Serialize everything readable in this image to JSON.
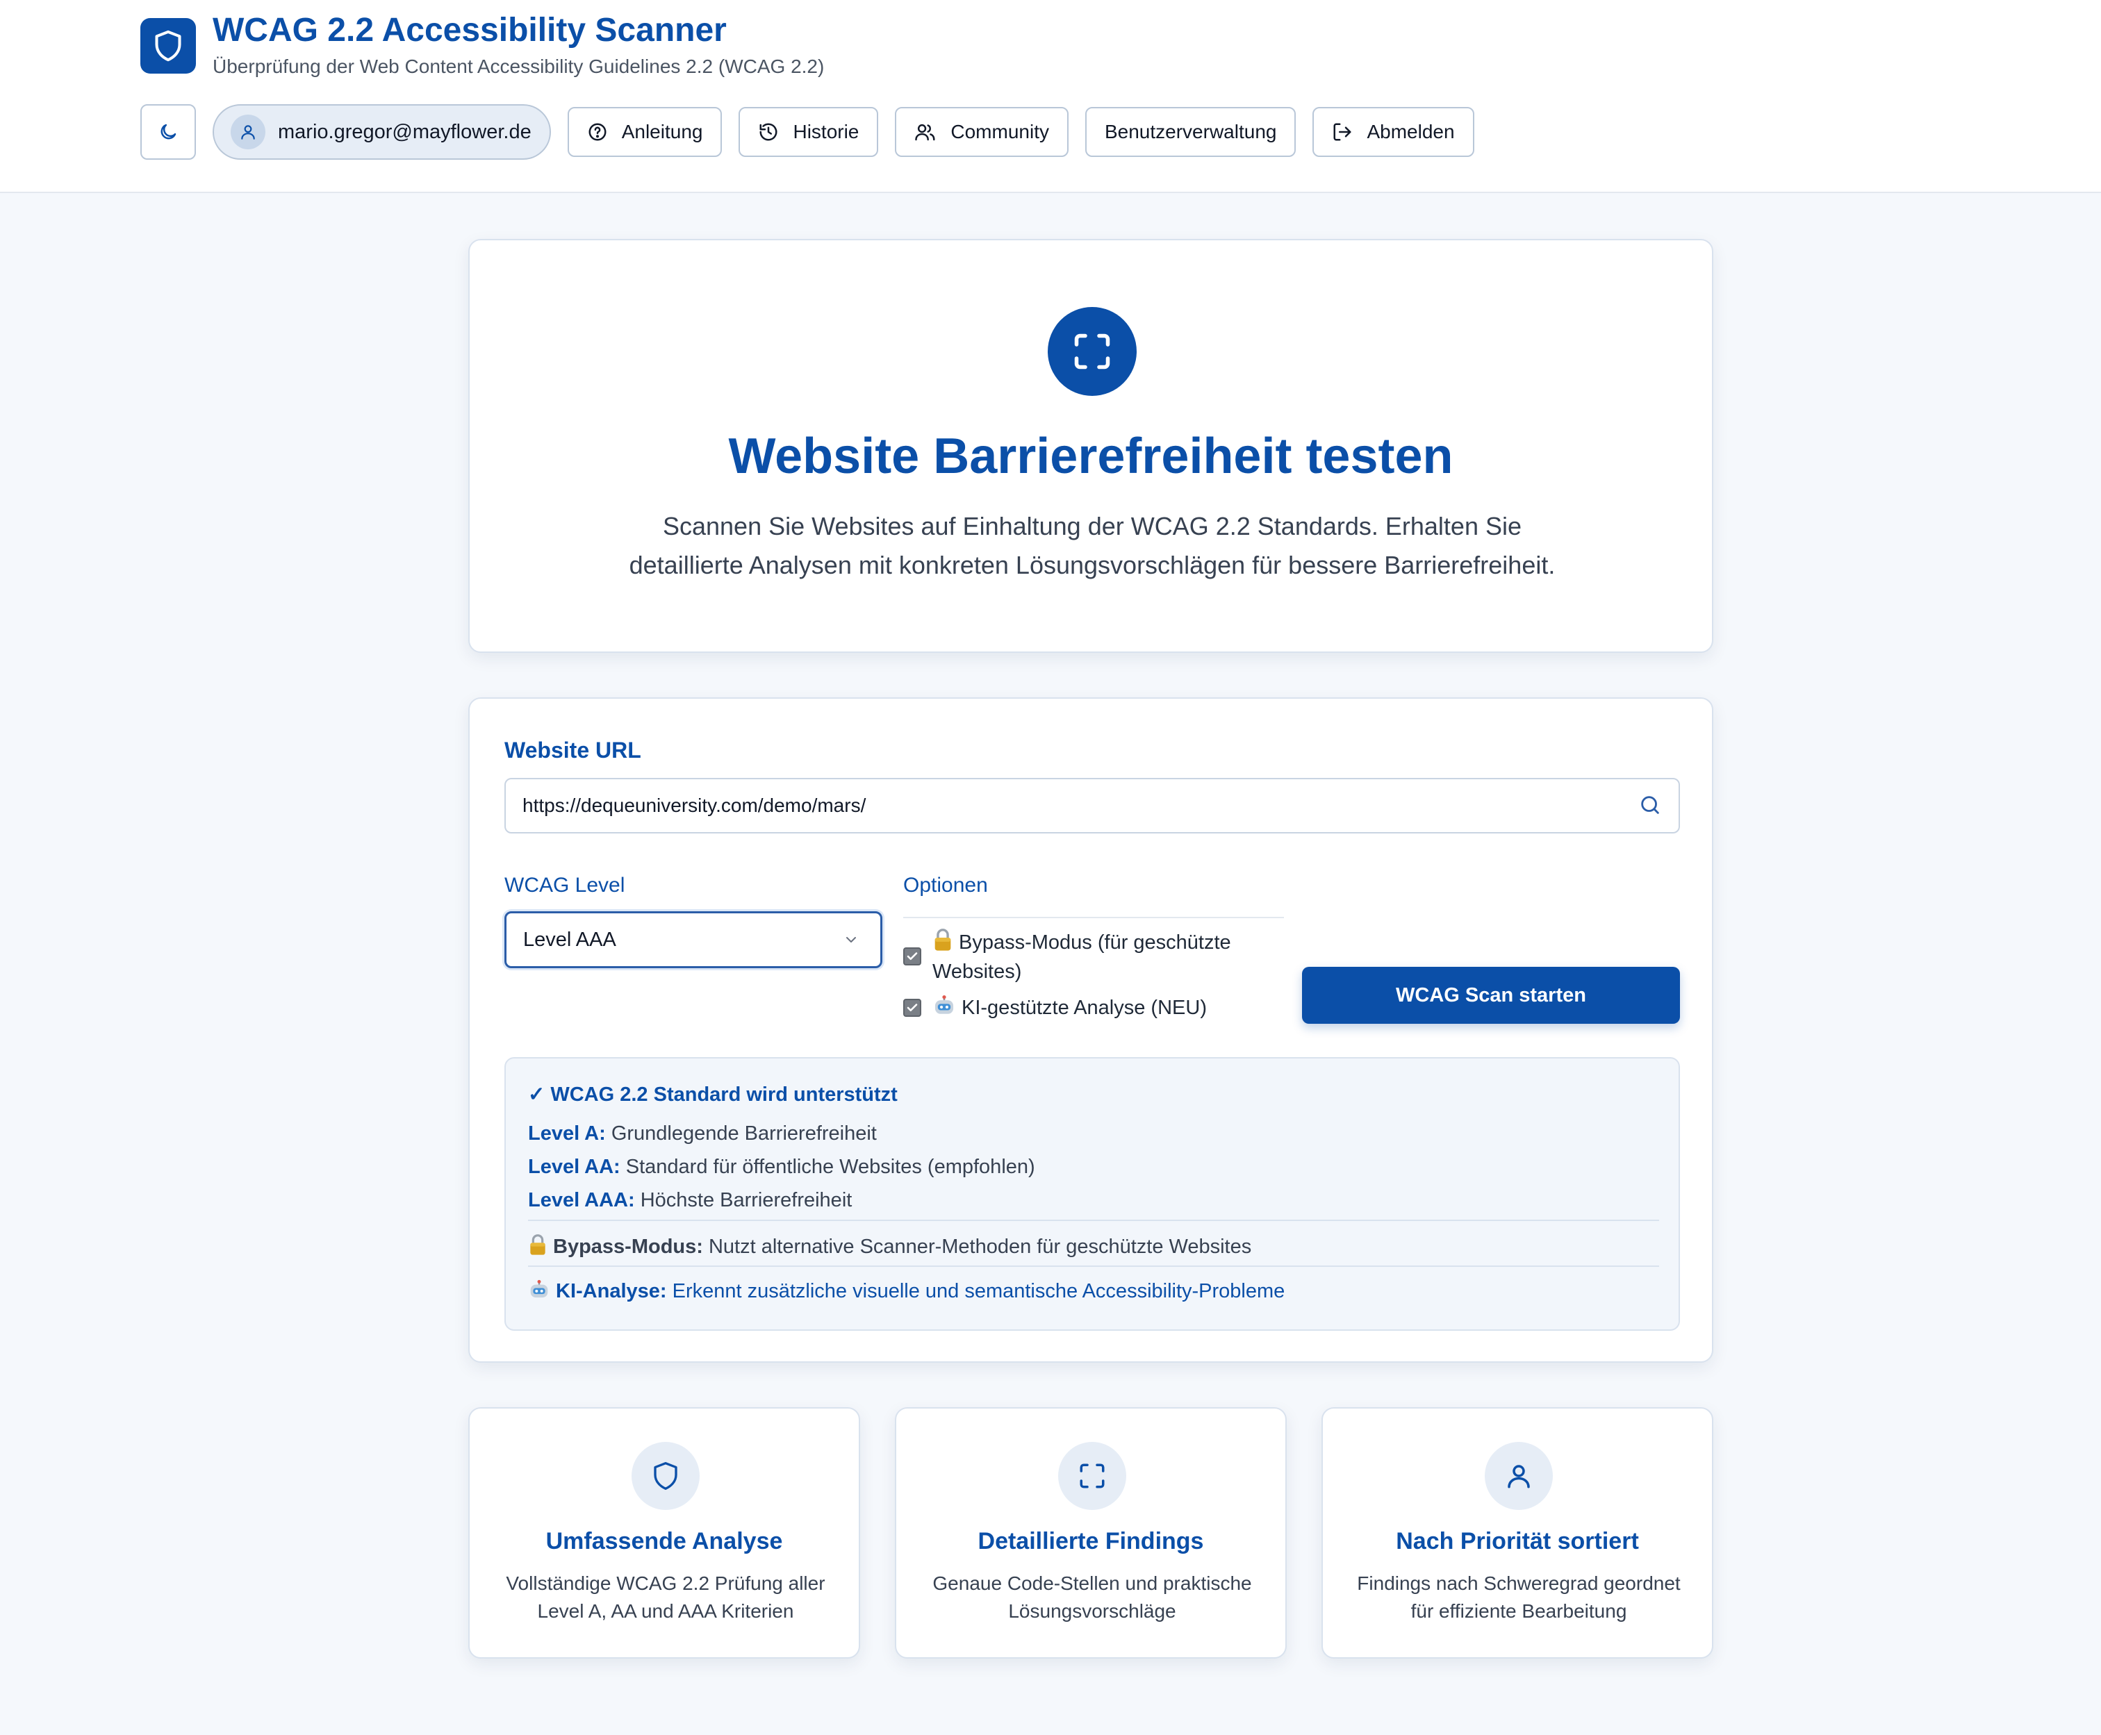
{
  "header": {
    "title": "WCAG 2.2 Accessibility Scanner",
    "subtitle": "Überprüfung der Web Content Accessibility Guidelines 2.2 (WCAG 2.2)",
    "logo_icon": "shield-icon",
    "theme_toggle_icon": "moon-icon",
    "user_email": "mario.gregor@mayflower.de",
    "nav": [
      {
        "label": "Anleitung",
        "icon": "help-circle-icon"
      },
      {
        "label": "Historie",
        "icon": "history-icon"
      },
      {
        "label": "Community",
        "icon": "users-icon"
      },
      {
        "label": "Benutzerverwaltung",
        "icon": ""
      },
      {
        "label": "Abmelden",
        "icon": "logout-icon"
      }
    ]
  },
  "hero": {
    "icon": "scan-icon",
    "title": "Website Barrierefreiheit testen",
    "description": "Scannen Sie Websites auf Einhaltung der WCAG 2.2 Standards. Erhalten Sie detaillierte Analysen mit konkreten Lösungsvorschlägen für bessere Barrierefreiheit."
  },
  "form": {
    "url_label": "Website URL",
    "url_value": "https://dequeuniversity.com/demo/mars/",
    "level_label": "WCAG Level",
    "level_value": "Level AAA",
    "options_label": "Optionen",
    "options": [
      {
        "label": "Bypass-Modus (für geschützte Websites)",
        "checked": true,
        "icon": "lock-emoji"
      },
      {
        "label": "KI-gestützte Analyse (NEU)",
        "checked": true,
        "icon": "robot-emoji"
      }
    ],
    "scan_button": "WCAG Scan starten"
  },
  "info": {
    "title": "✓ WCAG 2.2 Standard wird unterstützt",
    "levels": [
      {
        "name": "Level A:",
        "text": "Grundlegende Barrierefreiheit"
      },
      {
        "name": "Level AA:",
        "text": "Standard für öffentliche Websites (empfohlen)"
      },
      {
        "name": "Level AAA:",
        "text": "Höchste Barrierefreiheit"
      }
    ],
    "bypass": {
      "name": "Bypass-Modus:",
      "text": "Nutzt alternative Scanner-Methoden für geschützte Websites"
    },
    "ai": {
      "name": "KI-Analyse:",
      "text": "Erkennt zusätzliche visuelle und semantische Accessibility-Probleme"
    }
  },
  "features": [
    {
      "icon": "shield-icon",
      "title": "Umfassende Analyse",
      "description": "Vollständige WCAG 2.2 Prüfung aller Level A, AA und AAA Kriterien"
    },
    {
      "icon": "scan-icon",
      "title": "Detaillierte Findings",
      "description": "Genaue Code-Stellen und praktische Lösungsvorschläge"
    },
    {
      "icon": "user-icon",
      "title": "Nach Priorität sortiert",
      "description": "Findings nach Schweregrad geordnet für effiziente Bearbeitung"
    }
  ],
  "colors": {
    "primary": "#0b4fa8",
    "background": "#f5f8fc",
    "card": "#ffffff",
    "info_background": "#f2f6fb"
  }
}
